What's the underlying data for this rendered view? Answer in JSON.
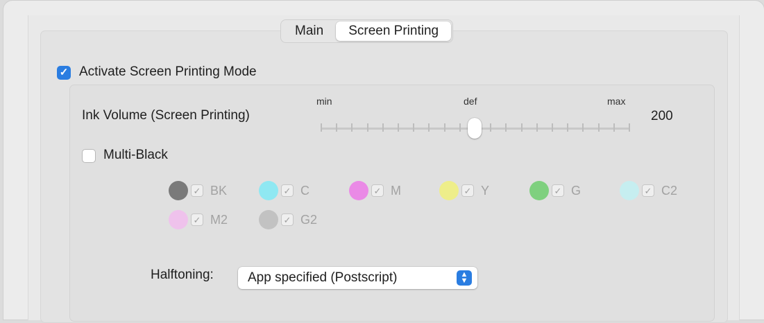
{
  "tabs": [
    {
      "label": "Main",
      "active": false
    },
    {
      "label": "Screen Printing",
      "active": true
    }
  ],
  "activate_mode": {
    "label": "Activate Screen Printing Mode",
    "checked": true
  },
  "ink_volume": {
    "label": "Ink Volume (Screen Printing)",
    "min_label": "min",
    "def_label": "def",
    "max_label": "max",
    "value": "200",
    "position_fraction": 0.5
  },
  "multi_black": {
    "label": "Multi-Black",
    "checked": false
  },
  "inks": [
    {
      "name": "BK",
      "color": "#7a7a7a"
    },
    {
      "name": "C",
      "color": "#8fe8f2"
    },
    {
      "name": "M",
      "color": "#ea8ae6"
    },
    {
      "name": "Y",
      "color": "#eeee8a"
    },
    {
      "name": "G",
      "color": "#7fd07f"
    },
    {
      "name": "C2",
      "color": "#c6eef0"
    },
    {
      "name": "M2",
      "color": "#efc2ec"
    },
    {
      "name": "G2",
      "color": "#c2c2c2"
    }
  ],
  "halftoning": {
    "label": "Halftoning:",
    "value": "App specified (Postscript)"
  },
  "colors": {
    "accent": "#2a7de1"
  }
}
